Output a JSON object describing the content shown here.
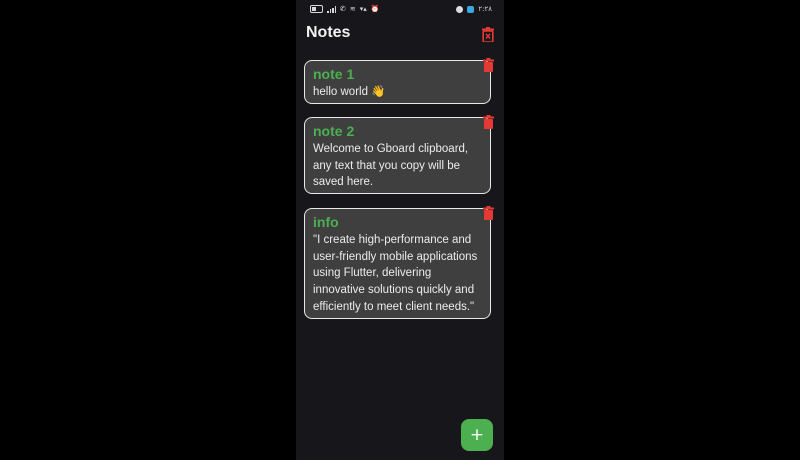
{
  "status_bar": {
    "left_icons": [
      "battery-icon",
      "signal-icon",
      "phone-icon",
      "wifi-icon",
      "data-icon",
      "alarm-icon"
    ],
    "time": "٢:٢٨",
    "right_icons": [
      "app-icon",
      "chip-icon"
    ]
  },
  "app_bar": {
    "title": "Notes",
    "clear_all_icon": "trash-icon"
  },
  "notes": [
    {
      "title": "note 1",
      "body": "hello world 👋"
    },
    {
      "title": "note 2",
      "body": "Welcome to Gboard clipboard, any text that you copy will be saved here."
    },
    {
      "title": "info",
      "body": "\"I create high-performance and user-friendly mobile applications using Flutter, delivering innovative solutions quickly and efficiently to meet client needs.\""
    }
  ],
  "fab": {
    "label": "+",
    "icon": "plus-icon"
  },
  "colors": {
    "background": "#17161b",
    "card": "#3f3f3f",
    "accent": "#4caf50",
    "danger": "#e53935"
  }
}
